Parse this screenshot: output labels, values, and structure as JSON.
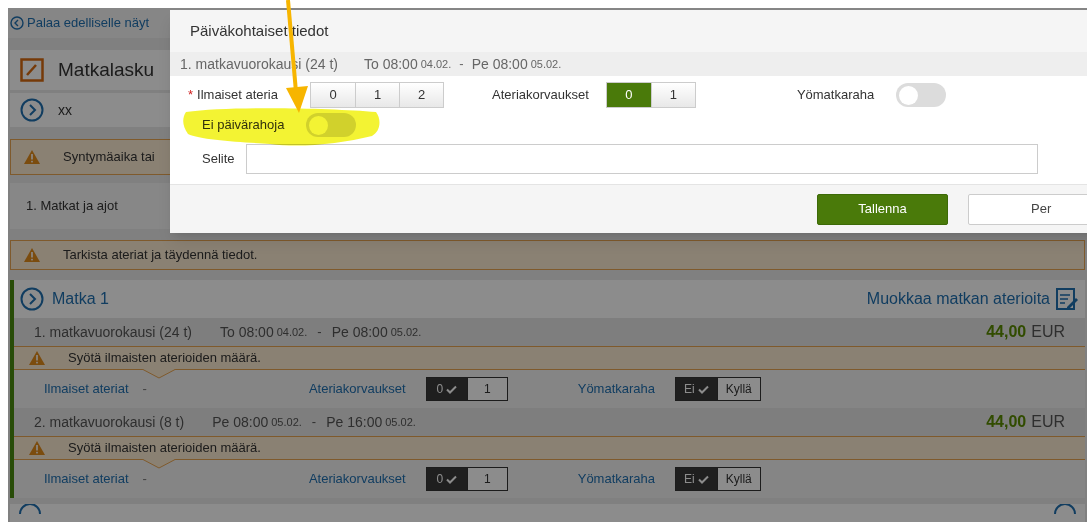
{
  "back_link": "Palaa edelliselle näyt",
  "header": {
    "title": "Matkalasku"
  },
  "person": {
    "name": "xx"
  },
  "birth_alert": "Syntymäaika tai",
  "section": "1. Matkat ja ajot",
  "check_alert": "Tarkista ateriat ja täydennä tiedot.",
  "trip": {
    "title": "Matka 1",
    "edit_link": "Muokkaa matkan aterioita",
    "days": [
      {
        "label": "1. matkavuorokausi (24 t)",
        "start_day": "To 08:00",
        "start_date": "04.02.",
        "separator": "-",
        "end_day": "Pe 08:00",
        "end_date": "05.02.",
        "amount": "44,00",
        "currency": "EUR",
        "warning": "Syötä ilmaisten aterioiden määrä.",
        "free_meals_label": "Ilmaiset ateriat",
        "free_meals_value": "-",
        "compensation_label": "Ateriakorvaukset",
        "compensation_options": [
          {
            "label": "0",
            "selected": true
          },
          {
            "label": "1",
            "selected": false
          }
        ],
        "night_label": "Yömatkaraha",
        "night_options": [
          {
            "label": "Ei",
            "selected": true
          },
          {
            "label": "Kyllä",
            "selected": false
          }
        ]
      },
      {
        "label": "2. matkavuorokausi (8 t)",
        "start_day": "Pe 08:00",
        "start_date": "05.02.",
        "separator": "-",
        "end_day": "Pe 16:00",
        "end_date": "05.02.",
        "amount": "44,00",
        "currency": "EUR",
        "warning": "Syötä ilmaisten aterioiden määrä.",
        "free_meals_label": "Ilmaiset ateriat",
        "free_meals_value": "-",
        "compensation_label": "Ateriakorvaukset",
        "compensation_options": [
          {
            "label": "0",
            "selected": true
          },
          {
            "label": "1",
            "selected": false
          }
        ],
        "night_label": "Yömatkaraha",
        "night_options": [
          {
            "label": "Ei",
            "selected": true
          },
          {
            "label": "Kyllä",
            "selected": false
          }
        ]
      }
    ]
  },
  "dialog": {
    "title": "Päiväkohtaiset tiedot",
    "day": {
      "label": "1. matkavuorokausi (24 t)",
      "start_day": "To 08:00",
      "start_date": "04.02.",
      "separator": "-",
      "end_day": "Pe 08:00",
      "end_date": "05.02."
    },
    "free_meals": {
      "label": "Ilmaiset ateria",
      "required_mark": "*",
      "options": [
        {
          "label": "0",
          "selected": false
        },
        {
          "label": "1",
          "selected": false
        },
        {
          "label": "2",
          "selected": false
        }
      ]
    },
    "compensation": {
      "label": "Ateriakorvaukset",
      "options": [
        {
          "label": "0",
          "selected": true
        },
        {
          "label": "1",
          "selected": false
        }
      ]
    },
    "night_allowance": {
      "label": "Yömatkaraha",
      "on": false
    },
    "no_daily_allowance": {
      "label": "Ei päivärahoja",
      "on": false
    },
    "note": {
      "label": "Selite"
    },
    "buttons": [
      {
        "label": "Tallenna",
        "kind": "primary"
      },
      {
        "label": "Per",
        "kind": "secondary"
      }
    ]
  }
}
